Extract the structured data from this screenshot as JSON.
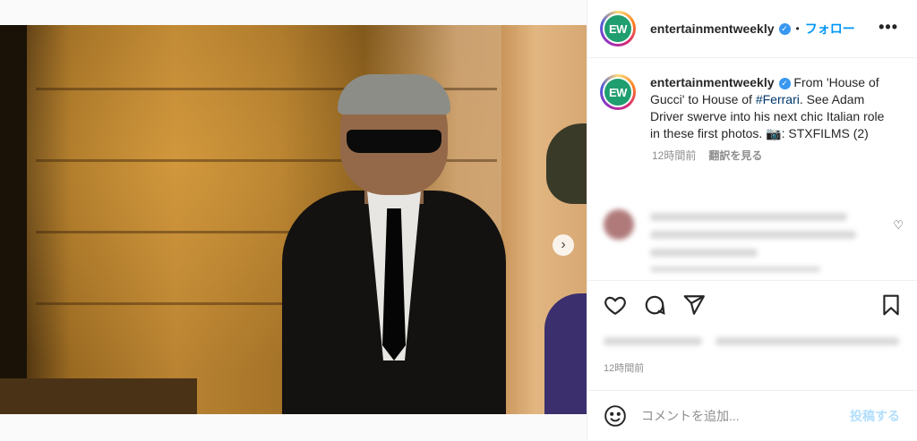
{
  "header": {
    "avatar_text": "EW",
    "username": "entertainmentweekly",
    "separator": "•",
    "follow_label": "フォロー",
    "more_label": "•••"
  },
  "caption": {
    "username": "entertainmentweekly",
    "text_before": " From 'House of Gucci' to House of ",
    "hashtag": "#Ferrari",
    "text_after": ". See Adam Driver swerve into his next chic Italian role in these first photos. 📷: STXFILMS (2)",
    "time": "12時間前",
    "translate_label": "翻訳を見る"
  },
  "post": {
    "time": "12時間前"
  },
  "comment_box": {
    "placeholder": "コメントを追加...",
    "post_label": "投稿する"
  },
  "carousel": {
    "next_label": "›",
    "slide_count": 2,
    "active_index": 0
  },
  "colors": {
    "follow": "#0095f6",
    "verified": "#3897f0",
    "post_disabled": "#b2dffc",
    "avatar_bg": "#1f9e6f"
  },
  "icons": {
    "verified": "check-badge",
    "like": "heart-outline",
    "comment": "speech-bubble",
    "share": "paper-plane",
    "save": "bookmark",
    "emoji": "smiley-face"
  }
}
